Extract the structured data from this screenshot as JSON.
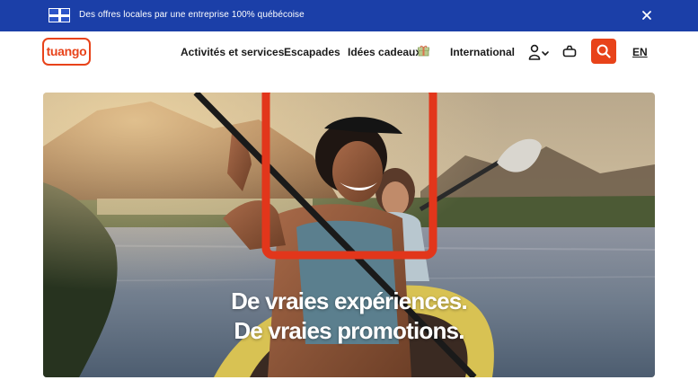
{
  "banner": {
    "text": "Des offres locales par une entreprise 100% québécoise",
    "flag_icon": "quebec-flag-icon",
    "close_icon": "close-icon"
  },
  "header": {
    "logo_text": "tuango",
    "nav": {
      "activities": "Activités et services",
      "getaways": "Escapades",
      "gift_ideas": "Idées cadeaux",
      "international": "International"
    },
    "gift_icon": "gift-icon",
    "account_icon": "user-icon",
    "cart_icon": "basket-icon",
    "search_icon": "search-icon",
    "language": "EN"
  },
  "hero": {
    "headline_line1": "De vraies expériences.",
    "headline_line2": "De vraies promotions."
  },
  "colors": {
    "banner_bg": "#1b3fa8",
    "brand_orange": "#e8431a",
    "highlight_frame": "#e2361b"
  }
}
